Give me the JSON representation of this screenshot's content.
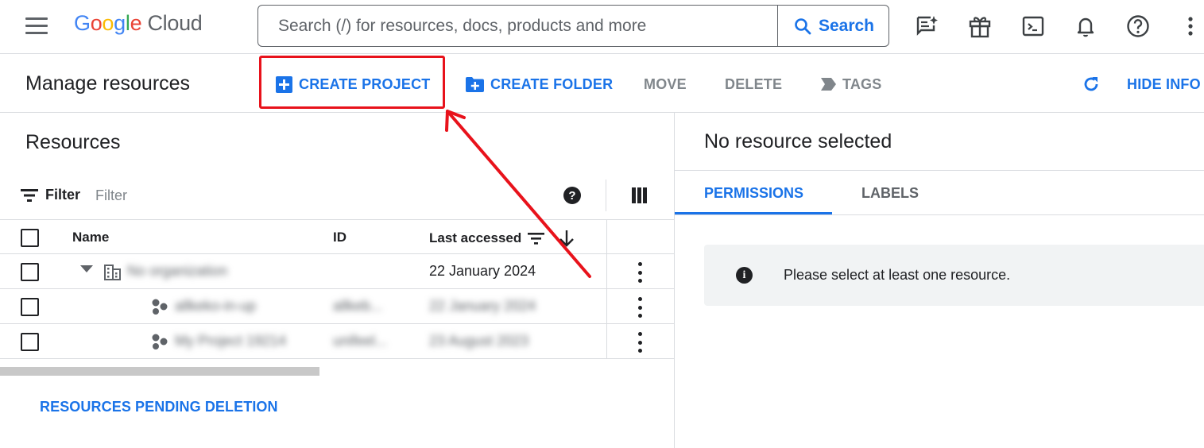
{
  "header": {
    "logo_letters": [
      {
        "ch": "G",
        "color": "#4285F4"
      },
      {
        "ch": "o",
        "color": "#EA4335"
      },
      {
        "ch": "o",
        "color": "#FBBC05"
      },
      {
        "ch": "g",
        "color": "#4285F4"
      },
      {
        "ch": "l",
        "color": "#34A853"
      },
      {
        "ch": "e",
        "color": "#EA4335"
      }
    ],
    "logo_suffix": " Cloud",
    "search_placeholder": "Search (/) for resources, docs, products and more",
    "search_button_label": "Search",
    "icons": [
      "ai-chat-icon",
      "gift-icon",
      "terminal-icon",
      "bell-icon",
      "help-icon",
      "more-vert-icon"
    ]
  },
  "toolbar": {
    "title": "Manage resources",
    "create_project": "CREATE PROJECT",
    "create_folder": "CREATE FOLDER",
    "move": "MOVE",
    "delete": "DELETE",
    "tags": "TAGS",
    "hide_info": "HIDE INFO"
  },
  "resources": {
    "title": "Resources",
    "filter_label": "Filter",
    "filter_placeholder": "Filter",
    "columns": {
      "name": "Name",
      "id": "ID",
      "last_accessed": "Last accessed"
    },
    "rows": [
      {
        "type": "organization",
        "name": "No organization",
        "id": "",
        "last_accessed": "22 January 2024",
        "blurred_date": false
      },
      {
        "type": "project",
        "name": "allkeko-in-up",
        "id": "allkeb...",
        "last_accessed": "22 January 2024",
        "blurred_date": true
      },
      {
        "type": "project",
        "name": "My Project 19214",
        "id": "unifeel...",
        "last_accessed": "23 August 2023",
        "blurred_date": true
      }
    ],
    "pending_link": "RESOURCES PENDING DELETION"
  },
  "info_panel": {
    "title": "No resource selected",
    "tabs": [
      {
        "label": "PERMISSIONS",
        "active": true
      },
      {
        "label": "LABELS",
        "active": false
      }
    ],
    "notice": "Please select at least one resource."
  },
  "colors": {
    "accent_blue": "#1a73e8",
    "highlight_red": "#e8121b"
  }
}
